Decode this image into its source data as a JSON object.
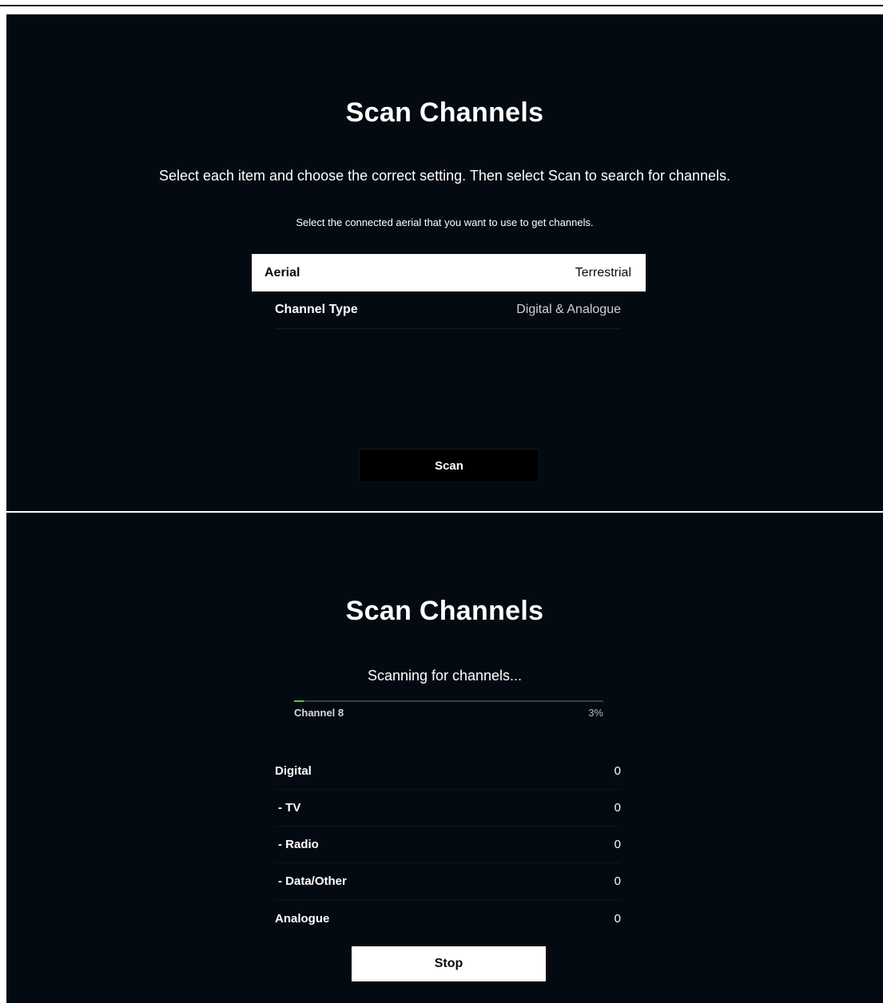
{
  "setup_screen": {
    "title": "Scan Channels",
    "instructions": "Select each item and choose the correct setting. Then select Scan to search for channels.",
    "hint": "Select the connected aerial that you want to use to get channels.",
    "settings": [
      {
        "label": "Aerial",
        "value": "Terrestrial",
        "focused": true
      },
      {
        "label": "Channel Type",
        "value": "Digital & Analogue",
        "focused": false
      }
    ],
    "scan_label": "Scan"
  },
  "scanning_screen": {
    "title": "Scan Channels",
    "status": "Scanning for channels...",
    "progress": {
      "channel_label": "Channel  8",
      "percent_label": "3%",
      "fraction": 0.03,
      "fill_color": "#5fc81e"
    },
    "counts": [
      {
        "label": "Digital",
        "value": "0"
      },
      {
        "label": "- TV",
        "value": "0"
      },
      {
        "label": "- Radio",
        "value": "0"
      },
      {
        "label": "- Data/Other",
        "value": "0"
      },
      {
        "label": "Analogue",
        "value": "0"
      }
    ],
    "stop_label": "Stop"
  }
}
